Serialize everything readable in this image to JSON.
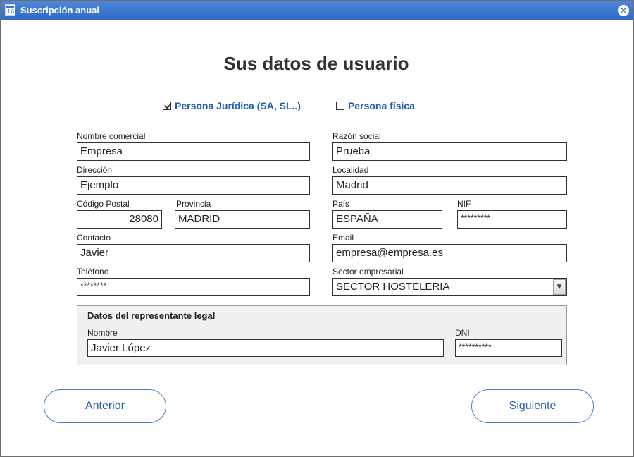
{
  "window": {
    "title": "Suscripción anual",
    "app_icon_text": "16"
  },
  "heading": "Sus datos de usuario",
  "person_type": {
    "juridica": {
      "label": "Persona Jurídica (SA, SL..)",
      "checked": true
    },
    "fisica": {
      "label": "Persona física",
      "checked": false
    }
  },
  "fields": {
    "nombre_comercial": {
      "label": "Nombre comercial",
      "value": "Empresa"
    },
    "razon_social": {
      "label": "Razón social",
      "value": "Prueba"
    },
    "direccion": {
      "label": "Dirección",
      "value": "Ejemplo"
    },
    "localidad": {
      "label": "Localidad",
      "value": "Madrid"
    },
    "codigo_postal": {
      "label": "Código Postal",
      "value": "28080"
    },
    "provincia": {
      "label": "Provincia",
      "value": "MADRID"
    },
    "pais": {
      "label": "País",
      "value": "ESPAÑA"
    },
    "nif": {
      "label": "NIF",
      "value": "*********"
    },
    "contacto": {
      "label": "Contacto",
      "value": "Javier"
    },
    "email": {
      "label": "Email",
      "value": "empresa@empresa.es"
    },
    "telefono": {
      "label": "Teléfono",
      "value": "********"
    },
    "sector": {
      "label": "Sector empresarial",
      "value": "SECTOR HOSTELERIA"
    }
  },
  "representante": {
    "title": "Datos del representante legal",
    "nombre": {
      "label": "Nombre",
      "value": "Javier López"
    },
    "dni": {
      "label": "DNI",
      "value": "**********"
    }
  },
  "buttons": {
    "anterior": "Anterior",
    "siguiente": "Siguiente"
  },
  "colors": {
    "titlebar": "#2e6ac6",
    "link": "#1c5eb3",
    "button_text": "#2a5fa8"
  }
}
